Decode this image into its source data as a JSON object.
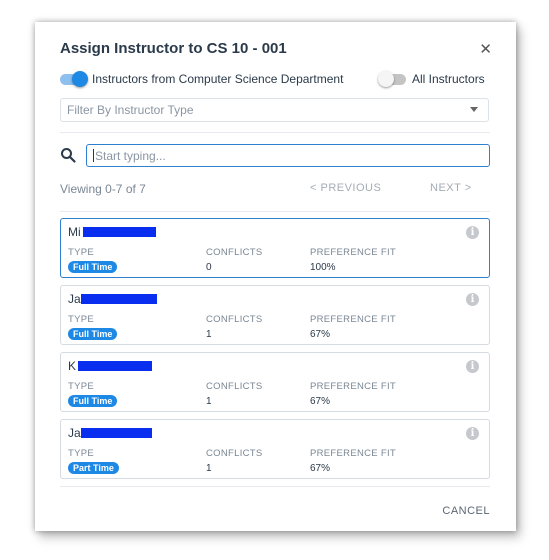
{
  "dialog": {
    "title": "Assign Instructor to CS 10 - 001",
    "close_icon": "close-icon",
    "cancel_label": "CANCEL"
  },
  "toggles": {
    "department": {
      "label": "Instructors from Computer Science Department",
      "on": true
    },
    "all": {
      "label": "All Instructors",
      "on": false
    }
  },
  "filter": {
    "placeholder": "Filter By Instructor Type"
  },
  "search": {
    "placeholder": "Start typing...",
    "icon": "search-icon"
  },
  "paging": {
    "viewing": "Viewing 0-7 of 7",
    "previous": "< PREVIOUS",
    "next": "NEXT >"
  },
  "columns": {
    "type": "TYPE",
    "conflicts": "CONFLICTS",
    "preference": "PREFERENCE FIT"
  },
  "instructors": [
    {
      "name": "Mi",
      "type": "Full Time",
      "conflicts": "0",
      "preference": "100%",
      "selected": true
    },
    {
      "name": "Ja",
      "type": "Full Time",
      "conflicts": "1",
      "preference": "67%",
      "selected": false
    },
    {
      "name": "K",
      "type": "Full Time",
      "conflicts": "1",
      "preference": "67%",
      "selected": false
    },
    {
      "name": "Ja",
      "type": "Part Time",
      "conflicts": "1",
      "preference": "67%",
      "selected": false
    }
  ],
  "colors": {
    "accent": "#1e88e5",
    "border_selected": "#2f7fd0",
    "redaction": "#0a2ef0"
  }
}
